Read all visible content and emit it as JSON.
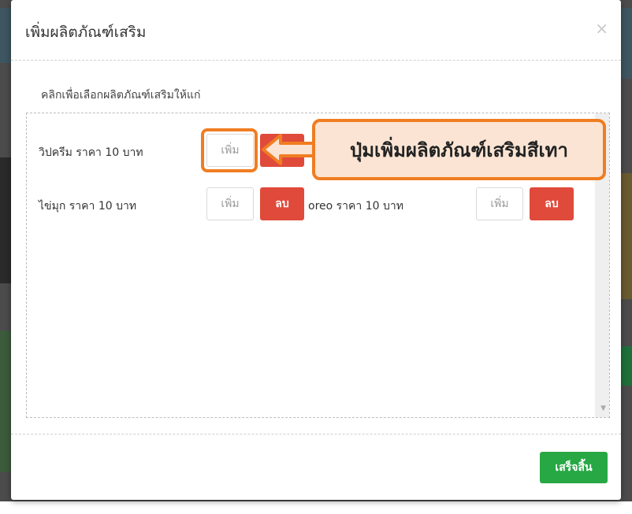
{
  "modal": {
    "title": "เพิ่มผลิตภัณฑ์เสริม",
    "close_label": "×",
    "instruction": "คลิกเพื่อเลือกผลิตภัณฑ์เสริมให้แก่",
    "items": [
      {
        "name": "วิปครีม ราคา 10 บาท",
        "add_label": "เพิ่ม",
        "delete_label": "ลบ"
      },
      {
        "name": "ไข่มุก ราคา 10 บาท",
        "add_label": "เพิ่ม",
        "delete_label": "ลบ"
      },
      {
        "name": "oreo ราคา 10 บาท",
        "add_label": "เพิ่ม",
        "delete_label": "ลบ"
      }
    ],
    "done_label": "เสร็จสิ้น"
  },
  "annotation": {
    "callout_text": "ปุ่มเพิ่มผลิตภัณฑ์เสริมสีเทา",
    "color": "#f07d22"
  },
  "colors": {
    "delete_button": "#e04a3b",
    "done_button": "#27a844"
  },
  "icons": {
    "close": "close-icon",
    "scroll_down": "chevron-down-icon",
    "callout_arrow": "arrow-left-icon"
  }
}
